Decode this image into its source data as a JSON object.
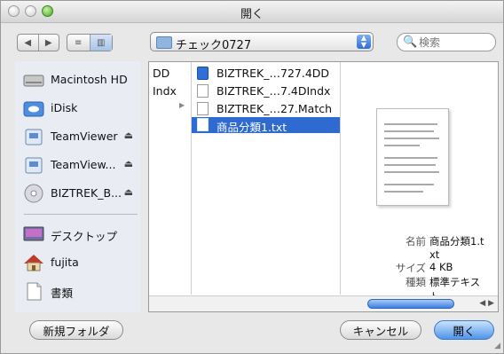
{
  "window": {
    "title": "開く"
  },
  "toolbar": {
    "back_label": "◀",
    "forward_label": "▶",
    "view_list_label": "≡",
    "view_column_label": "▥",
    "path_folder": "チェック0727",
    "search_placeholder": "検索"
  },
  "sidebar": {
    "items": [
      {
        "label": "Macintosh HD",
        "icon": "hard-drive-icon"
      },
      {
        "label": "iDisk",
        "icon": "idisk-icon"
      },
      {
        "label": "TeamViewer",
        "icon": "disk-image-icon",
        "eject": "⏏"
      },
      {
        "label": "TeamView...",
        "icon": "disk-image-icon",
        "eject": "⏏"
      },
      {
        "label": "BIZTREK_B...",
        "icon": "cd-icon",
        "eject": "⏏"
      },
      {
        "label": "デスクトップ",
        "icon": "desktop-icon"
      },
      {
        "label": "fujita",
        "icon": "home-icon"
      },
      {
        "label": "書類",
        "icon": "documents-icon"
      }
    ]
  },
  "browser": {
    "column_a": [
      "DD",
      "Indx"
    ],
    "column_b": [
      {
        "name": "BIZTREK_…727.4DD",
        "type": "app"
      },
      {
        "name": "BIZTREK_…7.4DIndx",
        "type": "doc"
      },
      {
        "name": "BIZTREK_…27.Match",
        "type": "doc"
      },
      {
        "name": "商品分類1.txt",
        "type": "doc",
        "selected": true
      }
    ],
    "preview": {
      "name_key": "名前",
      "name_value": "商品分類1.txt",
      "size_key": "サイズ",
      "size_value": "4 KB",
      "kind_key": "種類",
      "kind_value": "標準テキスト"
    }
  },
  "buttons": {
    "new_folder": "新規フォルダ",
    "cancel": "キャンセル",
    "open": "開く"
  }
}
